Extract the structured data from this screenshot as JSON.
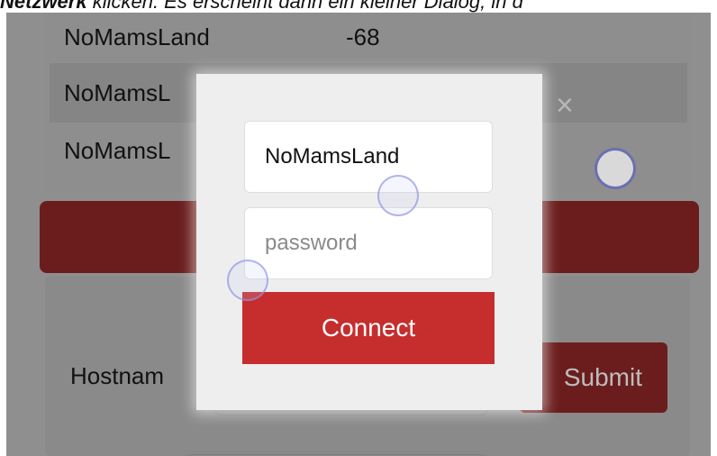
{
  "caption": {
    "bold": "Netzwerk",
    "text": " klicken. Es erscheint dann ein kleiner Dialog, in d"
  },
  "networks": [
    {
      "ssid": "NoMamsLand",
      "rssi": "-68"
    },
    {
      "ssid": "NoMamsL",
      "rssi": ""
    },
    {
      "ssid": "NoMamsL",
      "rssi": ""
    }
  ],
  "close_glyph": "×",
  "settings": {
    "hostname_label": "Hostnam",
    "submit_label": "Submit"
  },
  "dialog": {
    "ssid_value": "NoMamsLand",
    "password_placeholder": "password",
    "connect_label": "Connect"
  },
  "colors": {
    "accent": "#c62e2e",
    "accent_dimmed": "#6b1d1d",
    "overlay": "#8f8f8f",
    "dialog_bg": "#eeeeee"
  }
}
